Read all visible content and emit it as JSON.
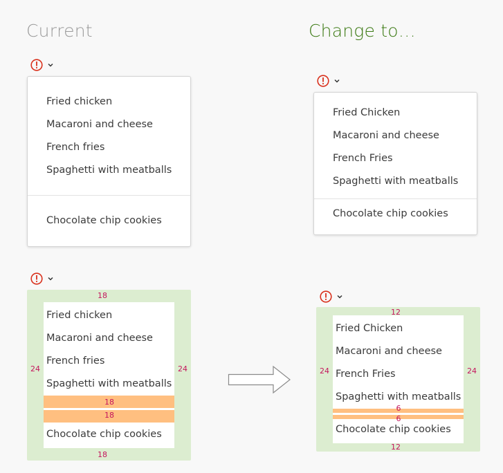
{
  "current": {
    "heading": "Current",
    "menu_items": [
      "Fried chicken",
      "Macaroni and cheese",
      "French fries",
      "Spaghetti with meatballs"
    ],
    "footer_item": "Chocolate chip cookies",
    "spec": {
      "items": [
        "Fried chicken",
        "Macaroni and cheese",
        "French fries",
        "Spaghetti with meatballs"
      ],
      "footer_item": "Chocolate chip cookies",
      "pad_top": "18",
      "pad_left": "24",
      "pad_right": "24",
      "pad_bottom": "18",
      "divider_top": "18",
      "divider_bottom": "18"
    }
  },
  "change": {
    "heading": "Change to…",
    "menu_items": [
      "Fried Chicken",
      "Macaroni and cheese",
      "French Fries",
      "Spaghetti with meatballs"
    ],
    "footer_item": "Chocolate chip cookies",
    "spec": {
      "items": [
        "Fried Chicken",
        "Macaroni and cheese",
        "French Fries",
        "Spaghetti with meatballs"
      ],
      "footer_item": "Chocolate chip cookies",
      "pad_top": "12",
      "pad_left": "24",
      "pad_right": "24",
      "pad_bottom": "12",
      "divider_top": "6",
      "divider_bottom": "6"
    }
  },
  "colors": {
    "current_heading": "#9a9a9a",
    "change_heading": "#3c7a14",
    "alert_red": "#d9301c",
    "padding_green": "#dcedd0",
    "divider_orange": "#ffbf80",
    "measure_pink": "#c4145c"
  },
  "icons": [
    "alert-circle-icon",
    "chevron-down-icon",
    "right-arrow-icon"
  ]
}
